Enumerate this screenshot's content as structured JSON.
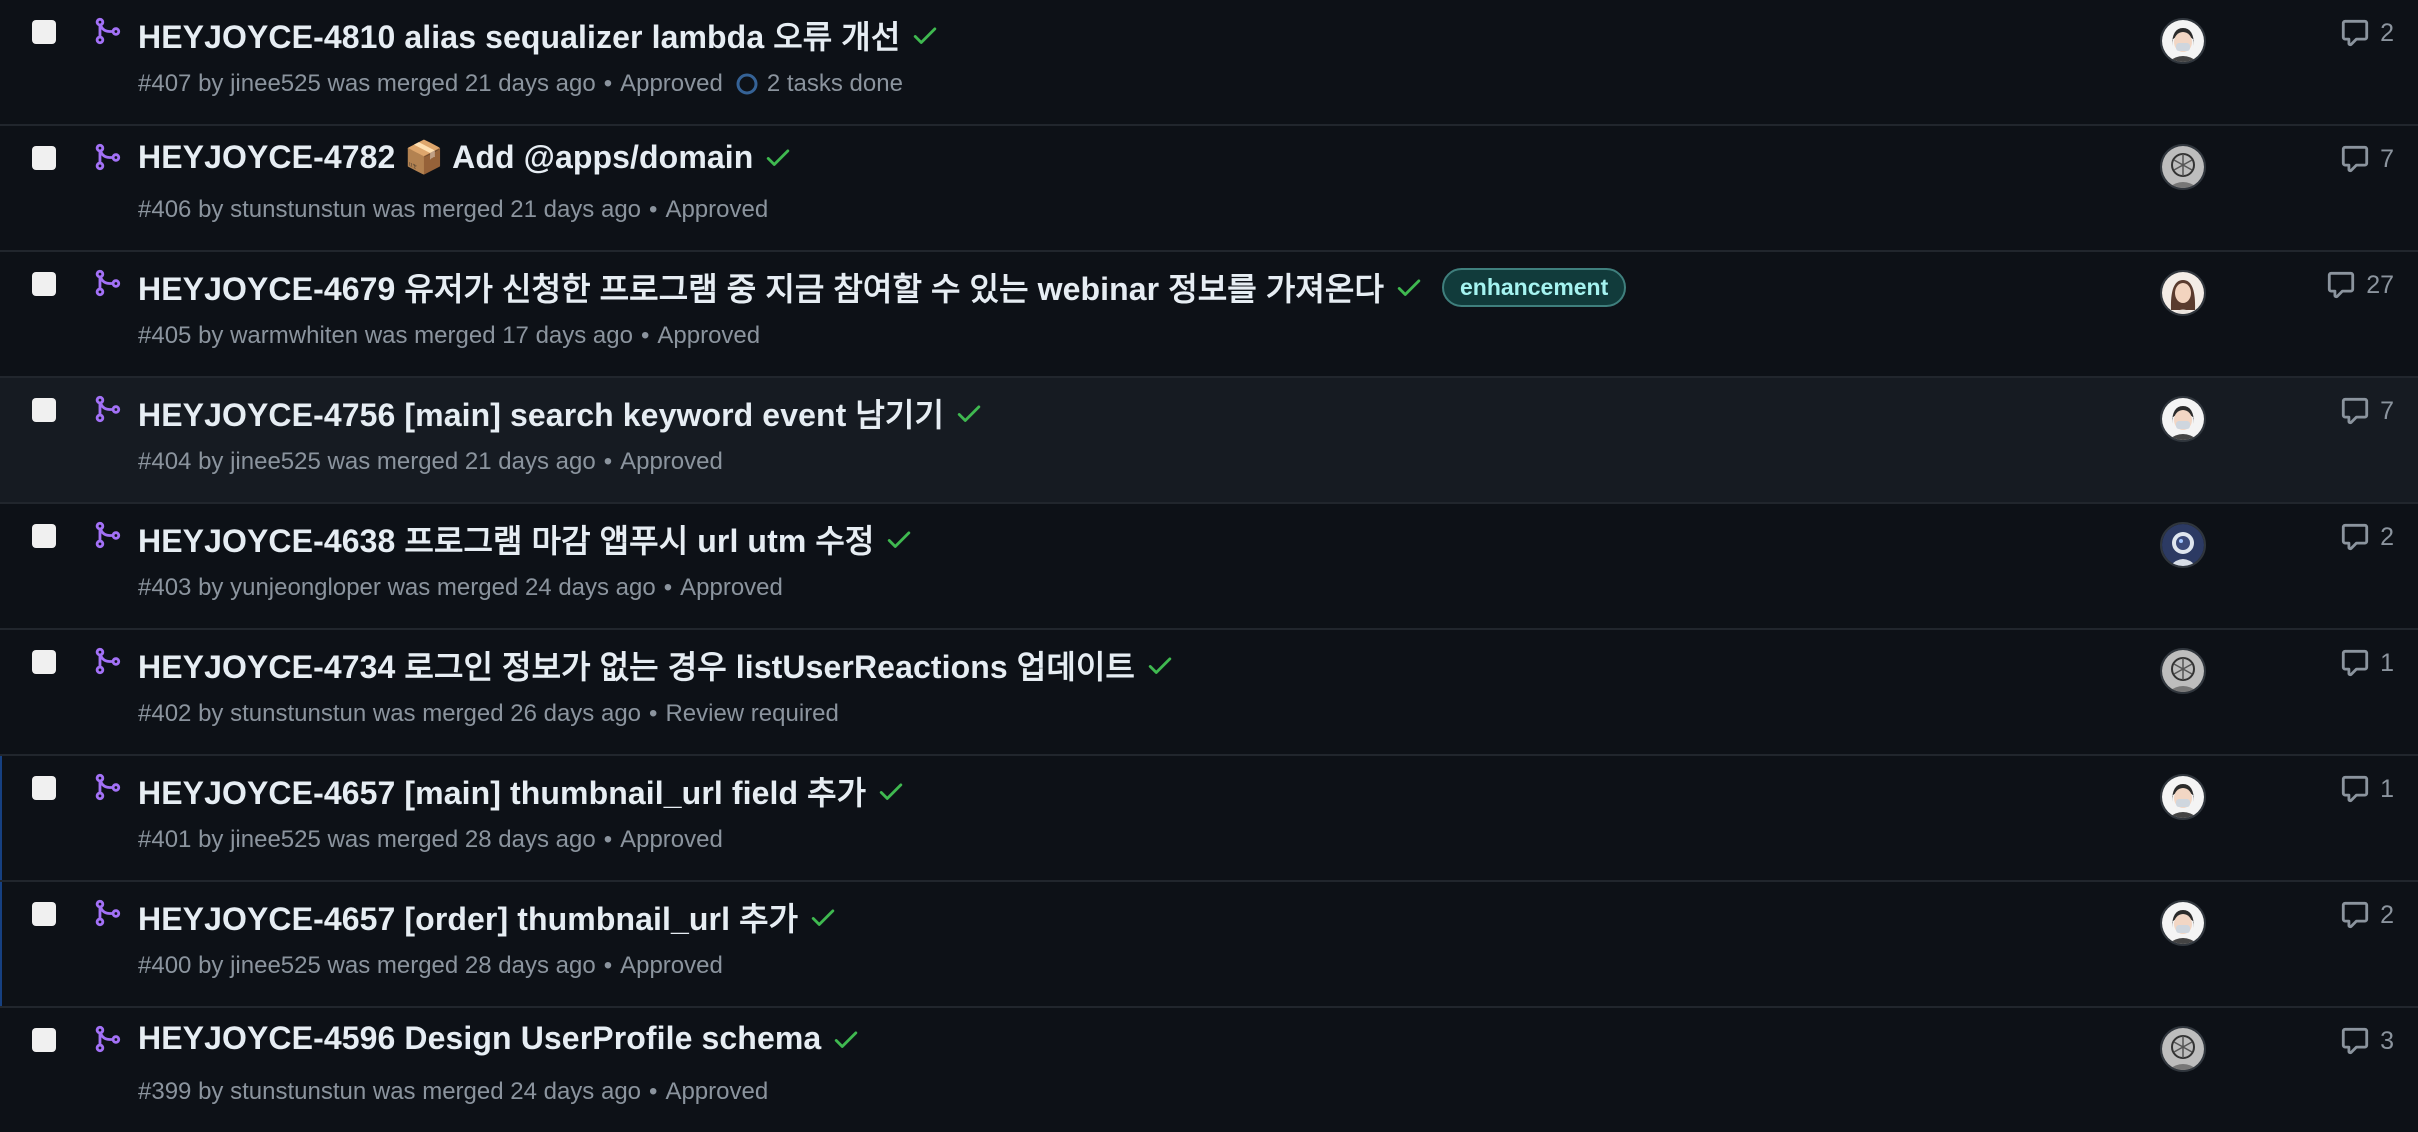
{
  "pull_requests": [
    {
      "title": "HEYJOYCE-4810 alias sequalizer lambda 오류 개선",
      "number": "#407",
      "author": "jinee525",
      "merged": "was merged 21 days ago",
      "review": "Approved",
      "tasks": "2 tasks done",
      "label": "",
      "comments": "2",
      "avatar": "mask"
    },
    {
      "title": "HEYJOYCE-4782 📦 Add @apps/domain",
      "number": "#406",
      "author": "stunstunstun",
      "merged": "was merged 21 days ago",
      "review": "Approved",
      "tasks": "",
      "label": "",
      "comments": "7",
      "avatar": "sketch"
    },
    {
      "title": "HEYJOYCE-4679 유저가 신청한 프로그램 중 지금 참여할 수 있는 webinar 정보를 가져온다",
      "number": "#405",
      "author": "warmwhiten",
      "merged": "was merged 17 days ago",
      "review": "Approved",
      "tasks": "",
      "label": "enhancement",
      "comments": "27",
      "avatar": "girl"
    },
    {
      "title": "HEYJOYCE-4756 [main] search keyword event 남기기",
      "number": "#404",
      "author": "jinee525",
      "merged": "was merged 21 days ago",
      "review": "Approved",
      "tasks": "",
      "label": "",
      "comments": "7",
      "avatar": "mask"
    },
    {
      "title": "HEYJOYCE-4638 프로그램 마감 앱푸시 url utm 수정",
      "number": "#403",
      "author": "yunjeongloper",
      "merged": "was merged 24 days ago",
      "review": "Approved",
      "tasks": "",
      "label": "",
      "comments": "2",
      "avatar": "astro"
    },
    {
      "title": "HEYJOYCE-4734 로그인 정보가 없는 경우 listUserReactions 업데이트",
      "number": "#402",
      "author": "stunstunstun",
      "merged": "was merged 26 days ago",
      "review": "Review required",
      "tasks": "",
      "label": "",
      "comments": "1",
      "avatar": "sketch"
    },
    {
      "title": "HEYJOYCE-4657 [main] thumbnail_url field 추가",
      "number": "#401",
      "author": "jinee525",
      "merged": "was merged 28 days ago",
      "review": "Approved",
      "tasks": "",
      "label": "",
      "comments": "1",
      "avatar": "mask"
    },
    {
      "title": "HEYJOYCE-4657 [order] thumbnail_url 추가",
      "number": "#400",
      "author": "jinee525",
      "merged": "was merged 28 days ago",
      "review": "Approved",
      "tasks": "",
      "label": "",
      "comments": "2",
      "avatar": "mask"
    },
    {
      "title": "HEYJOYCE-4596 Design UserProfile schema",
      "number": "#399",
      "author": "stunstunstun",
      "merged": "was merged 24 days ago",
      "review": "Approved",
      "tasks": "",
      "label": "",
      "comments": "3",
      "avatar": "sketch"
    }
  ],
  "meta_text": {
    "by": "by",
    "bullet": "•"
  },
  "colors": {
    "merged_purple": "#a371f7",
    "success_green": "#3fb950",
    "muted": "#8b949e"
  },
  "icons": {
    "row_state": "git-merge-icon",
    "status": "check-icon",
    "comments": "comment-icon",
    "tasks": "task-progress-icon"
  }
}
